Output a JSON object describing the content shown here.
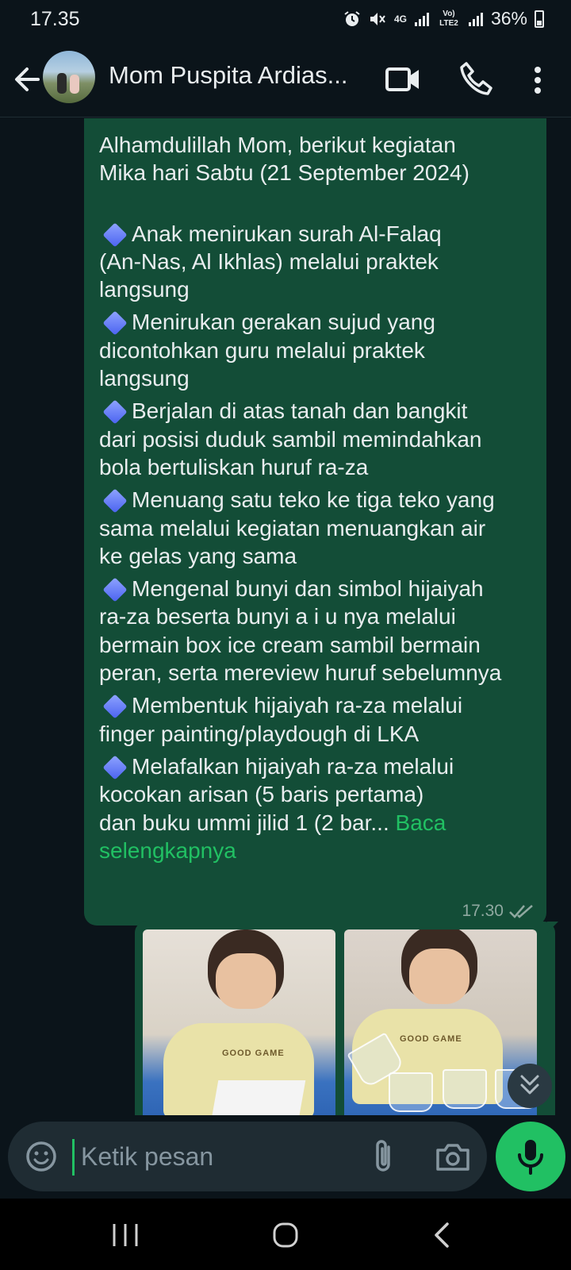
{
  "status_bar": {
    "time": "17.35",
    "network_4g": "4G",
    "network_volte": "Vo) LTE2",
    "battery": "36%"
  },
  "header": {
    "contact_name": "Mom Puspita Ardias..."
  },
  "message": {
    "lines": [
      "Alhamdulillah Mom, berikut kegiatan",
      "Mika hari Sabtu (21 September 2024)",
      "Anak menirukan surah Al-Falaq",
      "(An-Nas, Al Ikhlas) melalui praktek",
      "langsung",
      "Menirukan gerakan sujud yang",
      "dicontohkan guru melalui praktek",
      "langsung",
      "Berjalan di atas tanah dan bangkit",
      "dari posisi duduk sambil memindahkan",
      "bola bertuliskan huruf ra-za",
      "Menuang satu teko ke tiga teko yang",
      "sama melalui kegiatan menuangkan air",
      "ke gelas yang sama",
      "Mengenal bunyi dan simbol hijaiyah",
      "ra-za beserta bunyi a i u nya melalui",
      "bermain box ice cream sambil bermain",
      "peran, serta mereview huruf sebelumnya",
      "Membentuk hijaiyah ra-za melalui",
      "finger painting/playdough di LKA",
      "Melafalkan hijaiyah ra-za melalui",
      "kocokan arisan (5 baris pertama)",
      "dan buku ummi jilid 1 (2 bar... "
    ],
    "read_more_1": "Baca",
    "read_more_2": "selengkapnya",
    "time": "17.30",
    "bullet_icon": "blue-diamond-icon"
  },
  "photos": {
    "shirt_text_1": "GOOD GAME",
    "shirt_text_2": "GOOD GAME"
  },
  "input": {
    "placeholder": "Ketik pesan"
  },
  "colors": {
    "background": "#0b141a",
    "bubble": "#134d37",
    "accent": "#21c063",
    "input_bg": "#1f2c33"
  }
}
